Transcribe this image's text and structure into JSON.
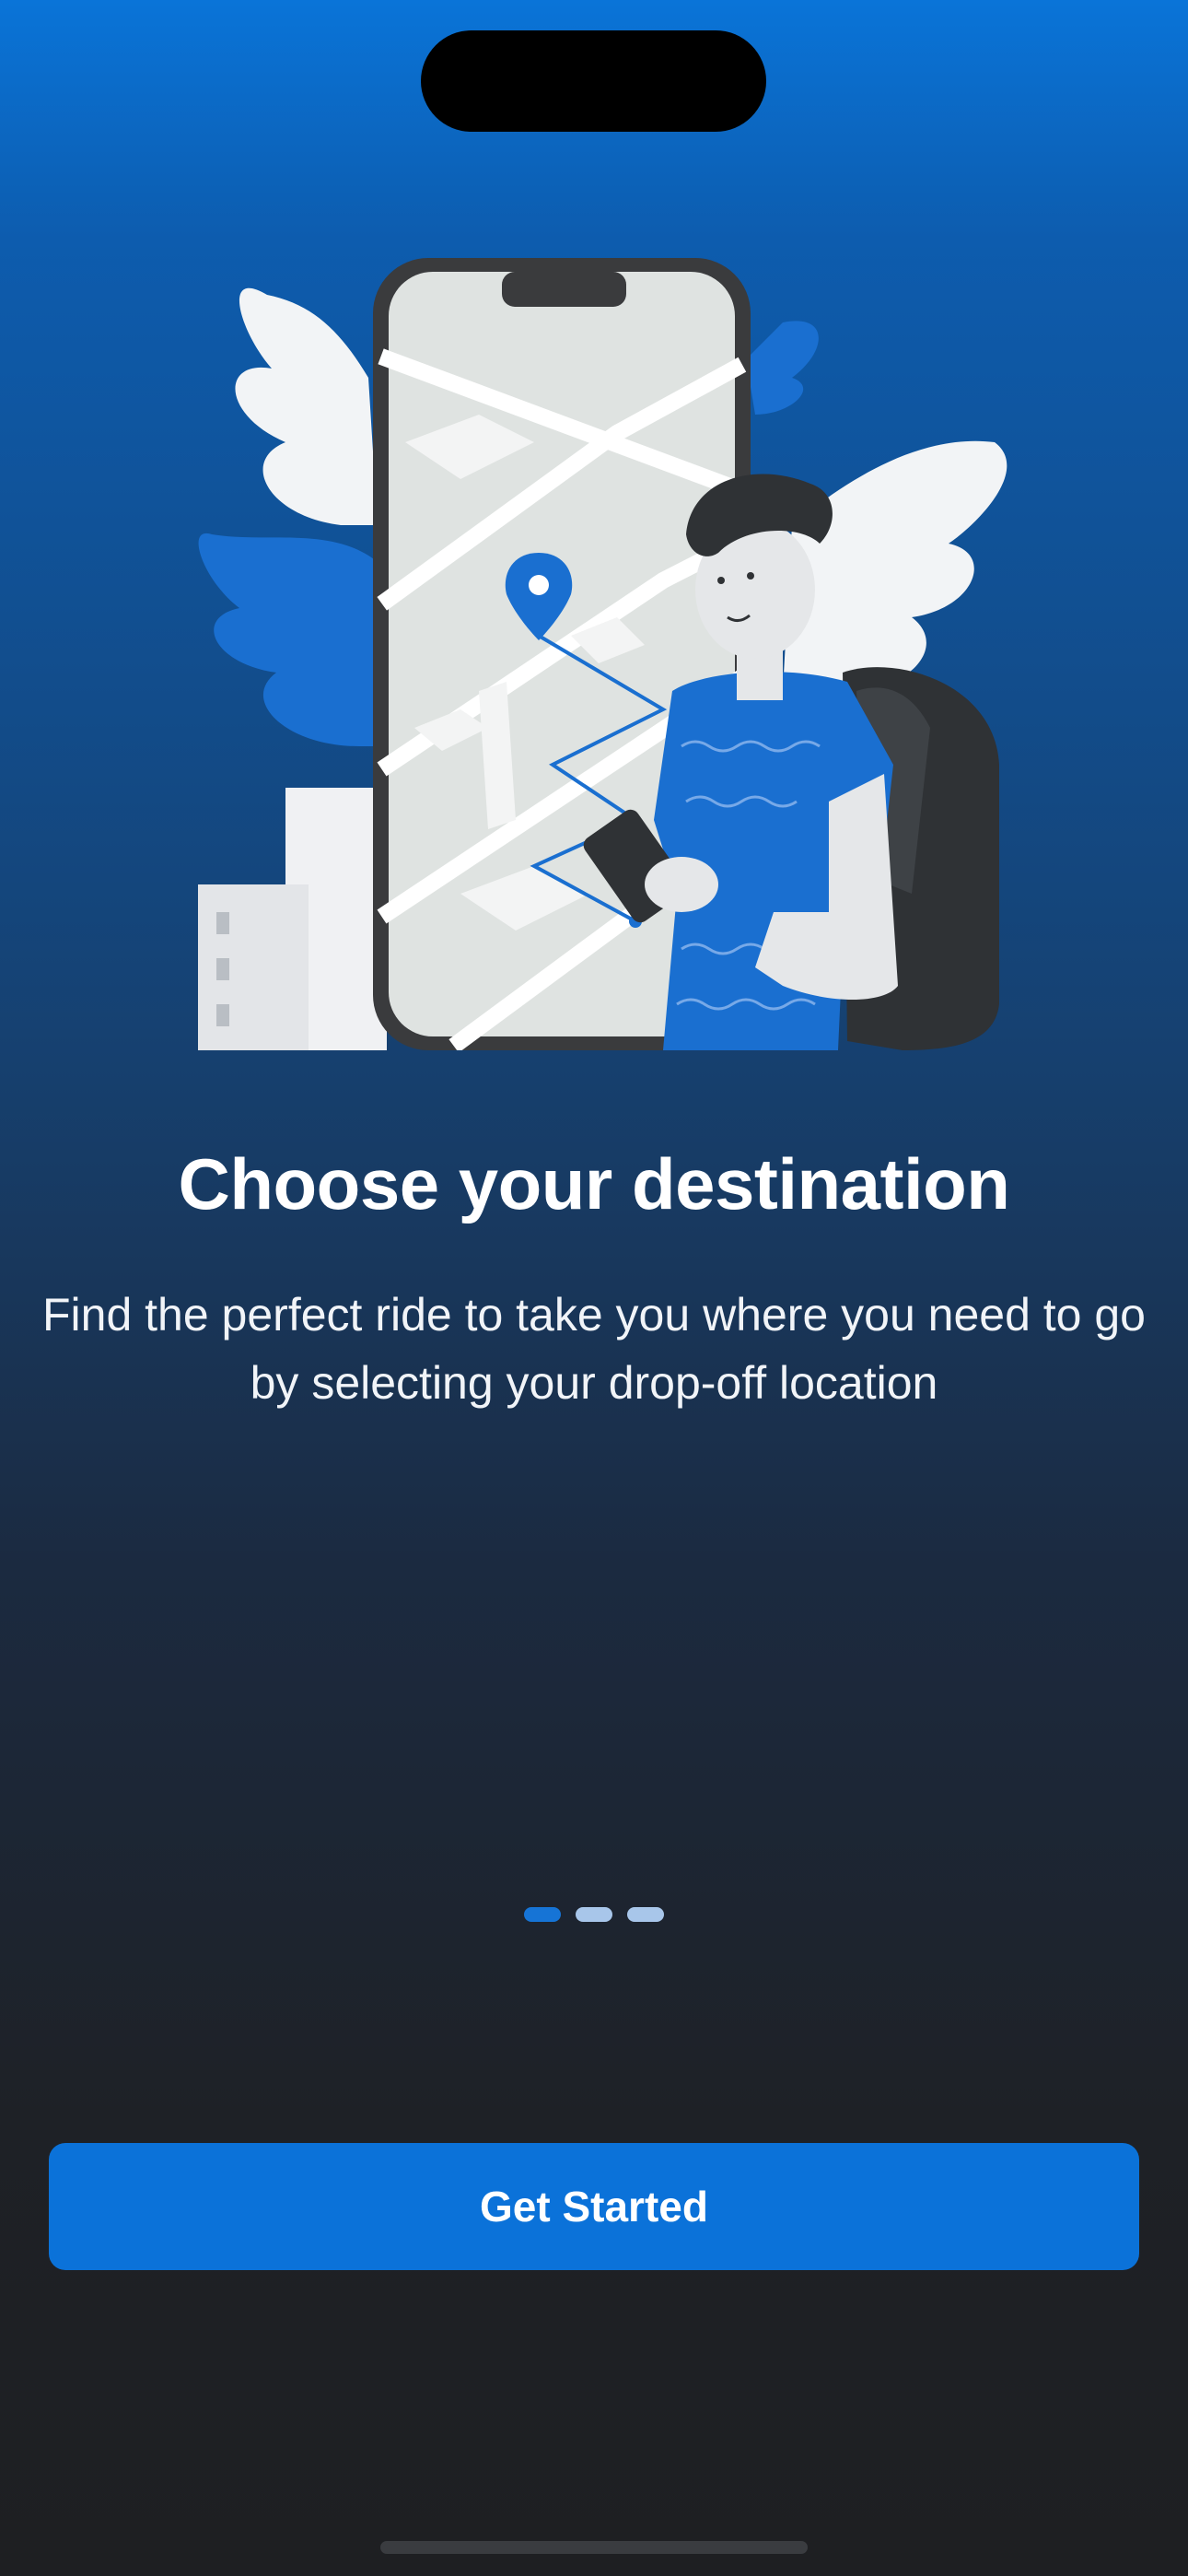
{
  "onboarding": {
    "title": "Choose your destination",
    "description": "Find the perfect ride to take you where you need to go by selecting your drop-off location",
    "pagination": {
      "total_pages": 3,
      "active_index": 0
    },
    "cta_label": "Get Started"
  },
  "colors": {
    "accent": "#0b72d9",
    "background_top": "#0a74d8",
    "background_bottom": "#1e1f22",
    "dot_active": "#1674d6",
    "dot_inactive": "#a8c6ea"
  },
  "icons": {
    "illustration": "person-holding-phone-with-map-route-illustration",
    "map_pin": "map-pin-icon"
  }
}
